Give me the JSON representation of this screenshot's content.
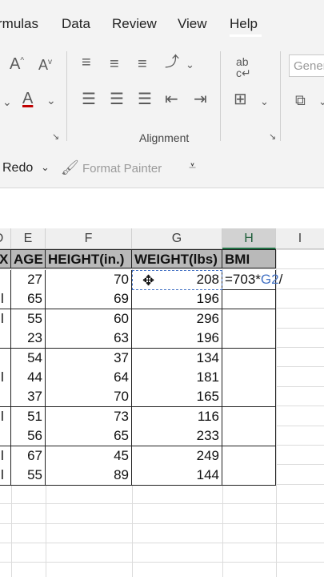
{
  "menu": {
    "formulas": "rmulas",
    "data": "Data",
    "review": "Review",
    "view": "View",
    "help": "Help"
  },
  "ribbon": {
    "alignment_label": "Alignment",
    "number_format": "Gener",
    "icons": [
      "increase-font-size-icon",
      "decrease-font-size-icon",
      "font-color-icon",
      "align-top-icon",
      "align-middle-icon",
      "align-bottom-icon",
      "orientation-icon",
      "wrap-text-icon",
      "align-left-icon",
      "align-center-icon",
      "align-right-icon",
      "decrease-indent-icon",
      "increase-indent-icon",
      "merge-center-icon",
      "number-format-icon"
    ]
  },
  "quick_access": {
    "redo": "Redo",
    "format_painter": "Format Painter"
  },
  "columns": [
    "D",
    "E",
    "F",
    "G",
    "H",
    "I"
  ],
  "table": {
    "headers": [
      "X",
      "AGE",
      "HEIGHT(in.)",
      "WEIGHT(lbs)",
      "BMI"
    ],
    "rows": [
      {
        "sex": "",
        "age": "27",
        "height": "70",
        "weight": "208",
        "bmi": "=703*G2/"
      },
      {
        "sex": "l",
        "age": "65",
        "height": "69",
        "weight": "196",
        "bmi": ""
      },
      {
        "sex": "l",
        "age": "55",
        "height": "60",
        "weight": "296",
        "bmi": ""
      },
      {
        "sex": "",
        "age": "23",
        "height": "63",
        "weight": "196",
        "bmi": ""
      },
      {
        "sex": "",
        "age": "54",
        "height": "37",
        "weight": "134",
        "bmi": ""
      },
      {
        "sex": "l",
        "age": "44",
        "height": "64",
        "weight": "181",
        "bmi": ""
      },
      {
        "sex": "",
        "age": "37",
        "height": "70",
        "weight": "165",
        "bmi": ""
      },
      {
        "sex": "l",
        "age": "51",
        "height": "73",
        "weight": "116",
        "bmi": ""
      },
      {
        "sex": "",
        "age": "56",
        "height": "65",
        "weight": "233",
        "bmi": ""
      },
      {
        "sex": "l",
        "age": "67",
        "height": "45",
        "weight": "249",
        "bmi": ""
      },
      {
        "sex": "l",
        "age": "55",
        "height": "89",
        "weight": "144",
        "bmi": ""
      }
    ]
  },
  "formula": {
    "prefix": "=703*",
    "ref": "G2",
    "suffix": "/"
  },
  "colors": {
    "reference_blue": "#4472c4",
    "selection_green": "#217346",
    "header_fill": "#b9b9b9"
  }
}
